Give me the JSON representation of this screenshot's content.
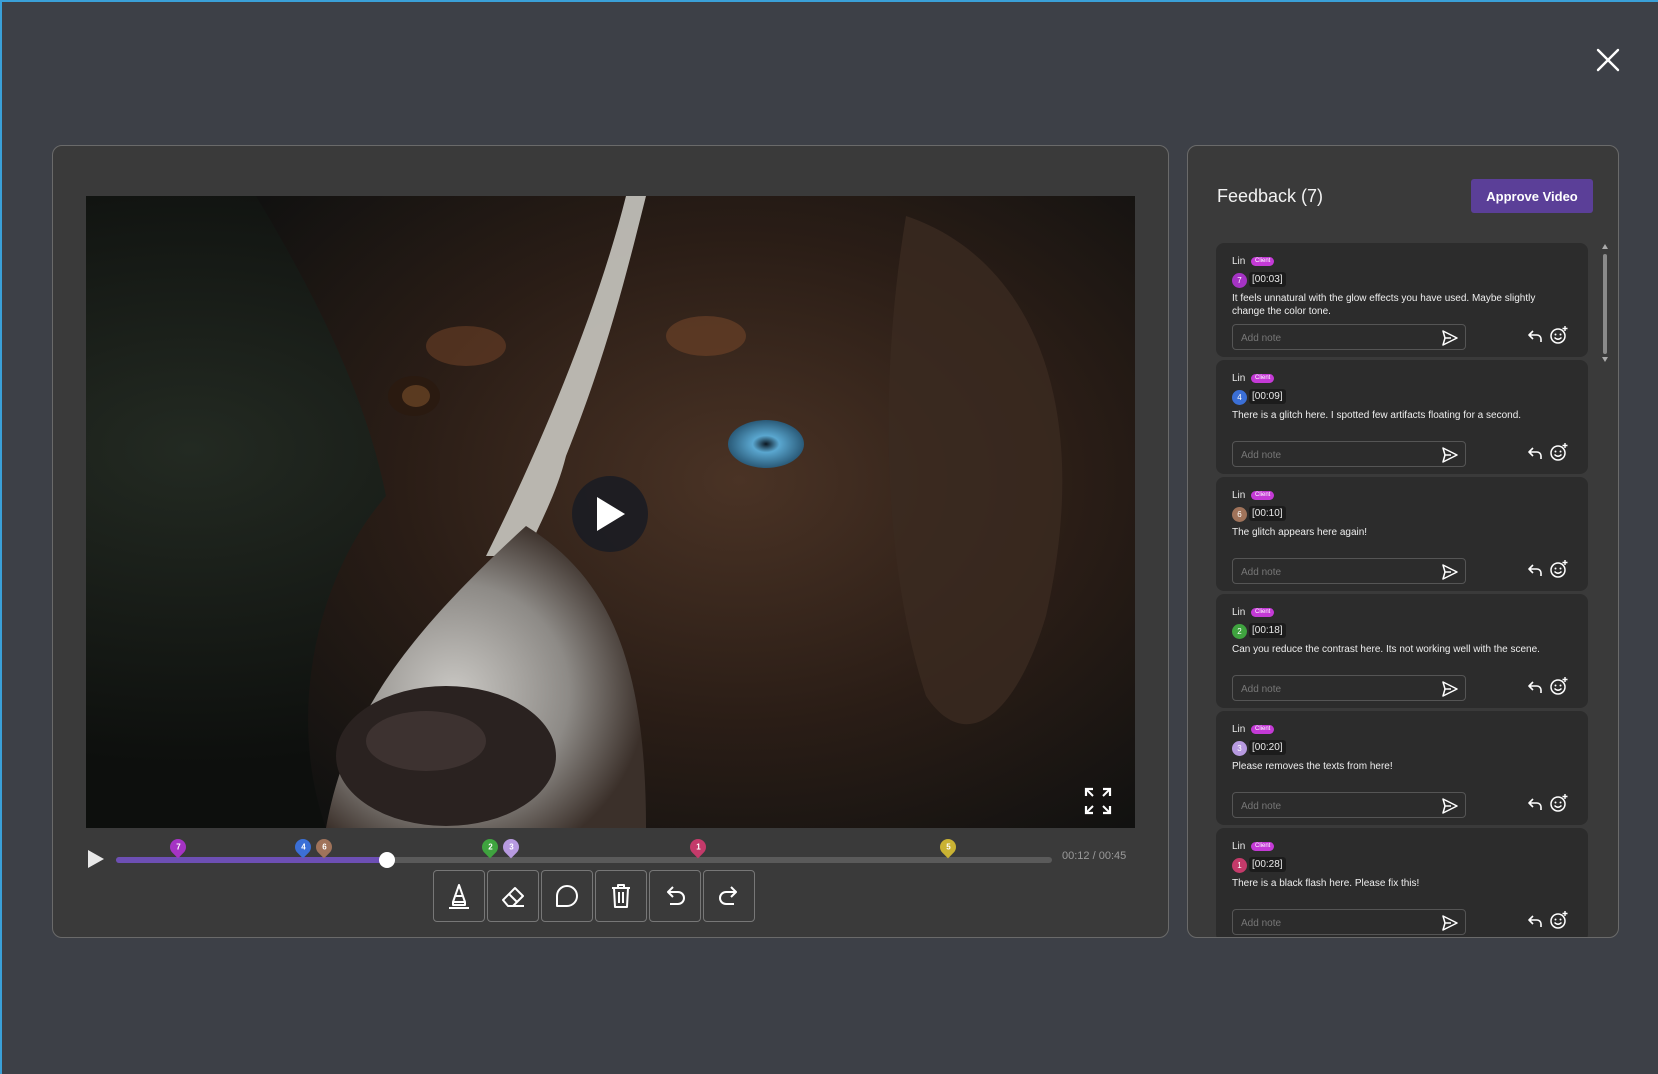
{
  "colors": {
    "accent": "#5b3f98",
    "timeline_progress": "#6d4fb4",
    "client_badge": "#c43ad6"
  },
  "toolbar": {
    "tools": [
      "highlighter-icon",
      "eraser-icon",
      "comment-shape-icon",
      "trash-icon",
      "undo-icon",
      "redo-icon"
    ]
  },
  "player": {
    "current_time": "00:12",
    "separator": "/",
    "duration": "00:45",
    "progress_fraction": 0.29,
    "markers": [
      {
        "label": "7",
        "color": "#a533c4",
        "time_sec": 3
      },
      {
        "label": "4",
        "color": "#3b6fd6",
        "time_sec": 9
      },
      {
        "label": "6",
        "color": "#a0735a",
        "time_sec": 10
      },
      {
        "label": "2",
        "color": "#3fa33f",
        "time_sec": 18
      },
      {
        "label": "3",
        "color": "#b79ae0",
        "time_sec": 19
      },
      {
        "label": "1",
        "color": "#c43a6a",
        "time_sec": 28
      },
      {
        "label": "5",
        "color": "#c9b233",
        "time_sec": 40
      }
    ]
  },
  "feedback": {
    "title": "Feedback (7)",
    "approve_label": "Approve Video",
    "note_placeholder": "Add note",
    "items": [
      {
        "author": "Lin",
        "role": "Client",
        "num": "7",
        "num_color": "#a533c4",
        "timestamp": "[00:03]",
        "message": "It feels unnatural with the glow effects you have used. Maybe slightly change the color tone."
      },
      {
        "author": "Lin",
        "role": "Client",
        "num": "4",
        "num_color": "#3b6fd6",
        "timestamp": "[00:09]",
        "message": "There is a glitch here. I spotted few artifacts floating for a second."
      },
      {
        "author": "Lin",
        "role": "Client",
        "num": "6",
        "num_color": "#a0735a",
        "timestamp": "[00:10]",
        "message": "The glitch appears here again!"
      },
      {
        "author": "Lin",
        "role": "Client",
        "num": "2",
        "num_color": "#3fa33f",
        "timestamp": "[00:18]",
        "message": "Can you reduce the contrast here. Its not working well with the scene."
      },
      {
        "author": "Lin",
        "role": "Client",
        "num": "3",
        "num_color": "#b79ae0",
        "timestamp": "[00:20]",
        "message": "Please removes the texts from here!"
      },
      {
        "author": "Lin",
        "role": "Client",
        "num": "1",
        "num_color": "#c43a6a",
        "timestamp": "[00:28]",
        "message": "There is a black flash  here. Please fix this!"
      }
    ]
  }
}
